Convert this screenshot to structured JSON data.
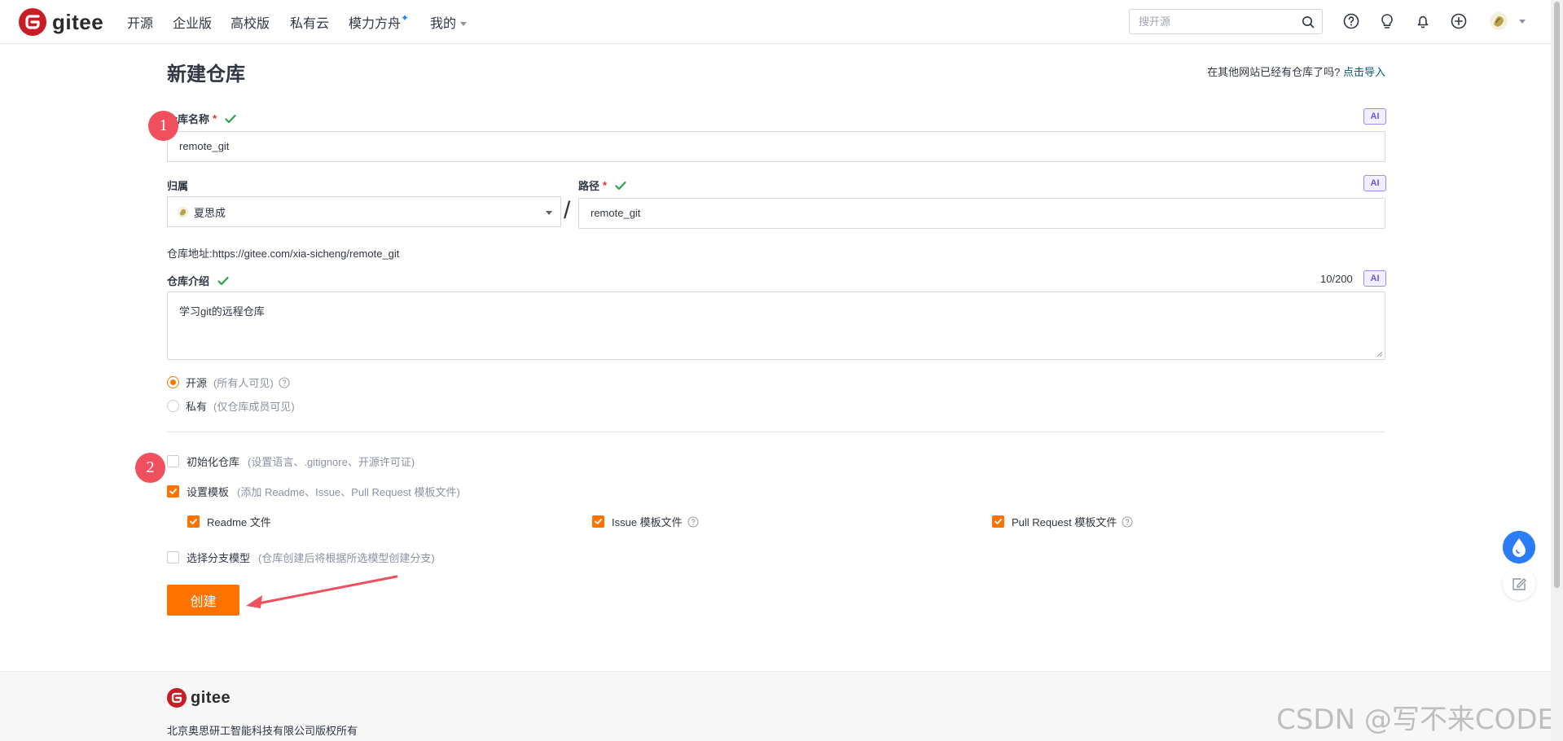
{
  "nav": {
    "logo_text": "gitee",
    "items": [
      {
        "label": "开源"
      },
      {
        "label": "企业版"
      },
      {
        "label": "高校版"
      },
      {
        "label": "私有云"
      },
      {
        "label": "模力方舟"
      },
      {
        "label": "我的"
      }
    ],
    "search_placeholder": "搜开源",
    "icons": [
      "help-icon",
      "lightbulb-icon",
      "bell-icon",
      "plus-circle-icon",
      "user-avatar"
    ]
  },
  "page": {
    "title": "新建仓库",
    "import_hint": "在其他网站已经有仓库了吗?",
    "import_link": "点击导入"
  },
  "form": {
    "repo_name_label": "仓库名称",
    "repo_name_value": "remote_git",
    "owner_label": "归属",
    "owner_value": "夏思成",
    "path_label": "路径",
    "path_value": "remote_git",
    "repo_url_label": "仓库地址:",
    "repo_url": "https://gitee.com/xia-sicheng/remote_git",
    "intro_label": "仓库介绍",
    "intro_count": "10/200",
    "intro_value": "学习git的远程仓库",
    "ai_label": "AI",
    "required_mark": "*",
    "visibility": [
      {
        "label": "开源",
        "hint": "(所有人可见)",
        "selected": true
      },
      {
        "label": "私有",
        "hint": "(仅仓库成员可见)",
        "selected": false
      }
    ],
    "init_repo": {
      "label": "初始化仓库",
      "hint": "(设置语言、.gitignore、开源许可证)",
      "checked": false
    },
    "set_template": {
      "label": "设置模板",
      "hint": "(添加 Readme、Issue、Pull Request 模板文件)",
      "checked": true
    },
    "templates": [
      {
        "label": "Readme 文件",
        "checked": true
      },
      {
        "label": "Issue 模板文件",
        "checked": true
      },
      {
        "label": "Pull Request 模板文件",
        "checked": true
      }
    ],
    "branch_model": {
      "label": "选择分支模型",
      "hint": "(仓库创建后将根据所选模型创建分支)",
      "checked": false
    },
    "create_button": "创建"
  },
  "annotations": {
    "step1": "1",
    "step2": "2"
  },
  "footer": {
    "logo_text": "gitee",
    "copyright": "北京奥思研工智能科技有限公司版权所有"
  },
  "watermark": "CSDN @写不来CODE",
  "colors": {
    "brand_red": "#c71d23",
    "accent_orange": "#fe7300",
    "check_green": "#2aa34a",
    "link_blue": "#005980",
    "annotation_red": "#f0505d"
  }
}
